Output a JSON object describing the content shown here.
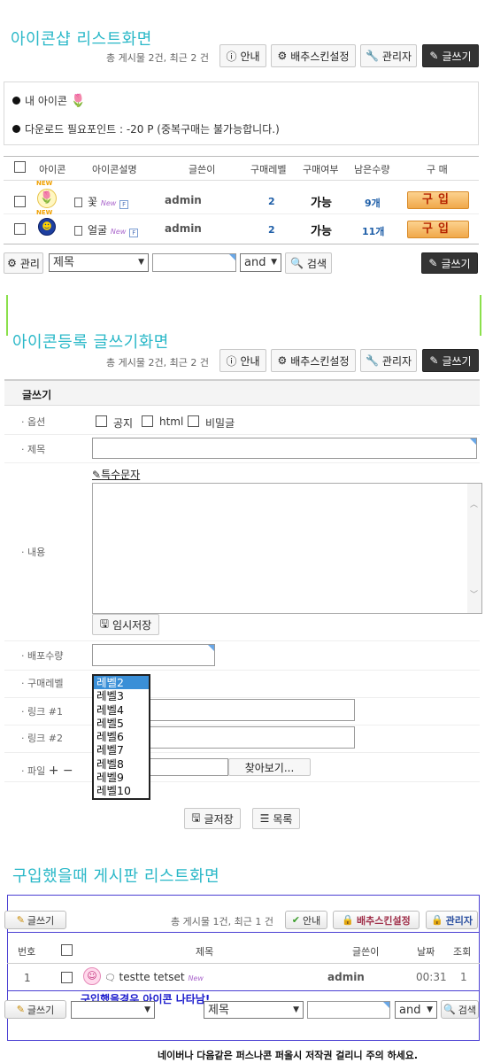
{
  "section1": {
    "title": "아이콘샵 리스트화면",
    "count_text": "총 게시물 2건, 최근 2 건",
    "btn_info": "안내",
    "btn_skin": "배추스킨설정",
    "btn_admin": "관리자",
    "btn_write": "글쓰기",
    "info_line1": "내 아이콘",
    "info_line2": "다운로드 필요포인트 : -20 P (중복구매는 불가능합니다.)",
    "headers": [
      "아이콘",
      "아이콘설명",
      "글쓴이",
      "구매레벨",
      "구매여부",
      "남은수량",
      "구 매"
    ],
    "rows": [
      {
        "name": "꽃",
        "new": "New",
        "f": "F",
        "author": "admin",
        "level": "2",
        "purchasable": "가능",
        "remaining": "9개",
        "buy": "구입",
        "badge": "NEW"
      },
      {
        "name": "얼굴",
        "new": "New",
        "f": "F",
        "author": "admin",
        "level": "2",
        "purchasable": "가능",
        "remaining": "11개",
        "buy": "구입",
        "badge": "NEW"
      }
    ],
    "btn_manage": "관리",
    "search_field": "제목",
    "search_op": "and",
    "btn_search": "검색",
    "btn_write2": "글쓰기"
  },
  "section2": {
    "title": "아이콘등록 글쓰기화면",
    "count_text": "총 게시물 2건, 최근 2 건",
    "btn_info": "안내",
    "btn_skin": "배추스킨설정",
    "btn_admin": "관리자",
    "btn_write": "글쓰기",
    "form_title": "글쓰기",
    "label_options": "· 옵션",
    "opt_notice": "공지",
    "opt_html": "html",
    "opt_secret": "비밀글",
    "label_subject": "· 제목",
    "special_chars": "특수문자",
    "label_content": "· 내용",
    "btn_tempsave": "임시저장",
    "label_quantity": "· 배포수량",
    "label_buylevel": "· 구매레벨",
    "label_link1": "· 링크 #1",
    "label_link2": "· 링크 #2",
    "label_file": "· 파일",
    "plus_minus": "+ −",
    "btn_browse": "찾아보기...",
    "levels": [
      "레벨2",
      "레벨3",
      "레벨4",
      "레벨5",
      "레벨6",
      "레벨7",
      "레벨8",
      "레벨9",
      "레벨10"
    ],
    "btn_save": "글저장",
    "btn_list": "목록"
  },
  "section3": {
    "title": "구입했을때 게시판 리스트화면",
    "btn_write": "글쓰기",
    "count_text": "총 게시물 1건, 최근 1 건",
    "btn_info": "안내",
    "btn_skin": "배추스킨설정",
    "btn_admin": "관리자",
    "headers": [
      "번호",
      "제목",
      "글쓴이",
      "날짜",
      "조회"
    ],
    "row": {
      "num": "1",
      "subject": "testte tetset",
      "new": "New",
      "author": "admin",
      "date": "00:31",
      "views": "1"
    },
    "annotation": "구입했을경우 아이콘 나타남!",
    "btn_write2": "글쓰기",
    "search_field": "제목",
    "search_op": "and",
    "btn_search": "검색"
  },
  "footer_note": "네이버나 다음같은 퍼스나콘 퍼올시 저작권 걸리니 주의 하세요.",
  "colors": {
    "heading": "#2ab8c8",
    "dark_button": "#333333",
    "buy_text": "#b52400",
    "purple_border": "#4a3fd3",
    "green_accent": "#8be04b"
  }
}
